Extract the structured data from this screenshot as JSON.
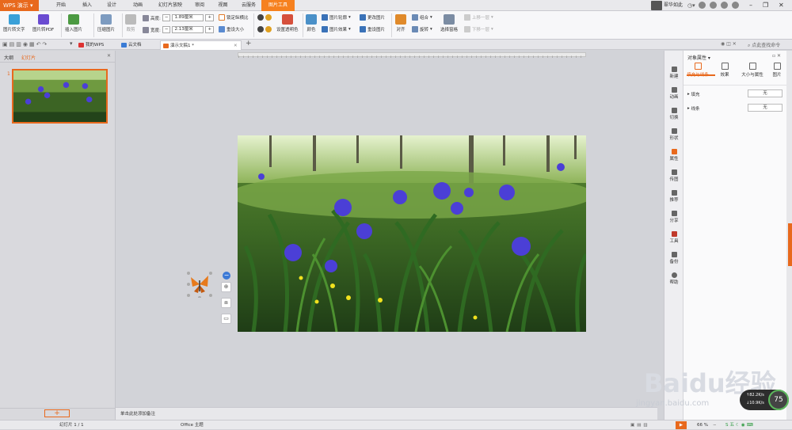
{
  "app": {
    "name": "WPS 演示"
  },
  "menu_tabs": [
    "开始",
    "插入",
    "设计",
    "动画",
    "幻灯片放映",
    "审阅",
    "视图",
    "云服务",
    "图片工具"
  ],
  "menu_active": "图片工具",
  "user": {
    "name": "翠华如此"
  },
  "ribbon": {
    "img_to_text": "图片转文字",
    "img_to_pdf": "图片转PDF",
    "insert_image": "插入图片",
    "compress_image": "压缩图片",
    "crop": "裁剪",
    "height_label": "高度:",
    "height_value": "1.89厘米",
    "width_label": "宽度:",
    "width_value": "2.13厘米",
    "lock_ratio": "锁定纵横比",
    "reset_size": "重设大小",
    "set_transparent": "设置透明色",
    "color": "颜色",
    "image_outline": "图片轮廓",
    "image_effect": "图片效果",
    "change_image": "更改图片",
    "reset_image": "重设图片",
    "align": "对齐",
    "group": "组合",
    "rotate": "旋转",
    "selection_pane": "选择窗格",
    "bring_forward": "上移一层",
    "send_backward": "下移一层"
  },
  "doc_tabs": [
    "我的WPS",
    "云文档",
    "演示文稿1 *"
  ],
  "search_placeholder": "点此查找命令",
  "left_pane": {
    "tab_outline": "大纲",
    "tab_slides": "幻灯片",
    "slide_number": "1"
  },
  "notes_placeholder": "单击此处添加备注",
  "status": {
    "slide_info": "幻灯片 1 / 1",
    "theme": "Office 主题",
    "zoom": "66 %"
  },
  "side_tools": [
    "新建",
    "动画",
    "切换",
    "形状",
    "属性",
    "传图",
    "推荐",
    "分享",
    "工具",
    "备份",
    "帮助"
  ],
  "props": {
    "title": "对象属性",
    "tabs": [
      "填充与线条",
      "效果",
      "大小与属性",
      "图片"
    ],
    "fill_label": "填充",
    "fill_value": "无",
    "line_label": "线条",
    "line_value": "无"
  },
  "speed_widget": {
    "percent": "75",
    "up": "82.2",
    "down": "10.9",
    "up_unit": "K/s",
    "down_unit": "K/s"
  },
  "watermark": {
    "brand": "Baidu经验",
    "url": "jingyan.baidu.com"
  },
  "colors": {
    "accent": "#f6811f",
    "app_orange": "#e8691d",
    "iris": "#4b3fd6",
    "foliage": "#3d6f24"
  }
}
